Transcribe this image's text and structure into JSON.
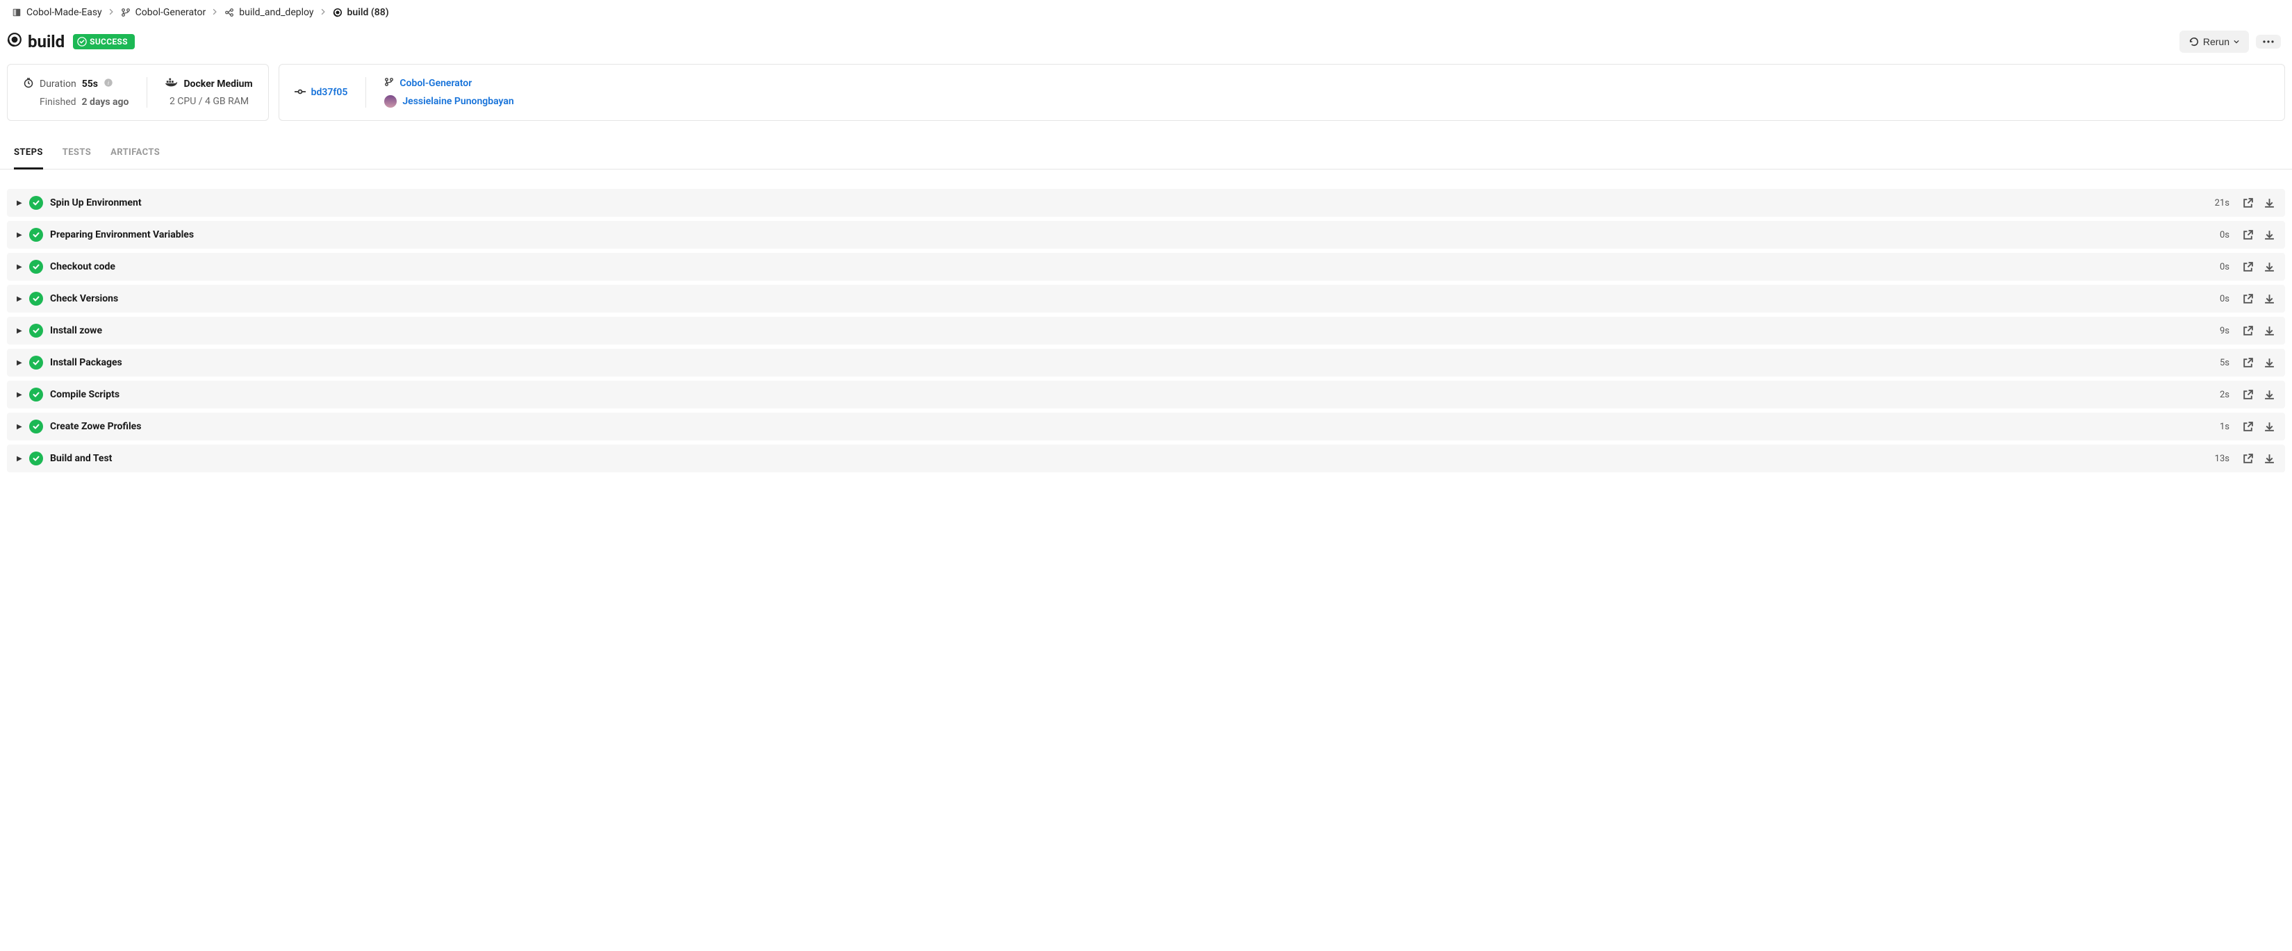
{
  "breadcrumb": [
    {
      "icon": "project",
      "label": "Cobol-Made-Easy"
    },
    {
      "icon": "branch",
      "label": "Cobol-Generator"
    },
    {
      "icon": "workflow",
      "label": "build_and_deploy"
    },
    {
      "icon": "job",
      "label": "build (88)"
    }
  ],
  "header": {
    "title": "build",
    "status_label": "SUCCESS",
    "rerun_label": "Rerun"
  },
  "meta": {
    "duration_label": "Duration",
    "duration_value": "55s",
    "finished_label": "Finished",
    "finished_value": "2 days ago",
    "executor": "Docker Medium",
    "resources": "2 CPU / 4 GB RAM",
    "commit": "bd37f05",
    "branch": "Cobol-Generator",
    "author": "Jessielaine Punongbayan"
  },
  "tabs": {
    "steps": "STEPS",
    "tests": "TESTS",
    "artifacts": "ARTIFACTS"
  },
  "steps": [
    {
      "name": "Spin Up Environment",
      "time": "21s"
    },
    {
      "name": "Preparing Environment Variables",
      "time": "0s"
    },
    {
      "name": "Checkout code",
      "time": "0s"
    },
    {
      "name": "Check Versions",
      "time": "0s"
    },
    {
      "name": "Install zowe",
      "time": "9s"
    },
    {
      "name": "Install Packages",
      "time": "5s"
    },
    {
      "name": "Compile Scripts",
      "time": "2s"
    },
    {
      "name": "Create Zowe Profiles",
      "time": "1s"
    },
    {
      "name": "Build and Test",
      "time": "13s"
    }
  ]
}
